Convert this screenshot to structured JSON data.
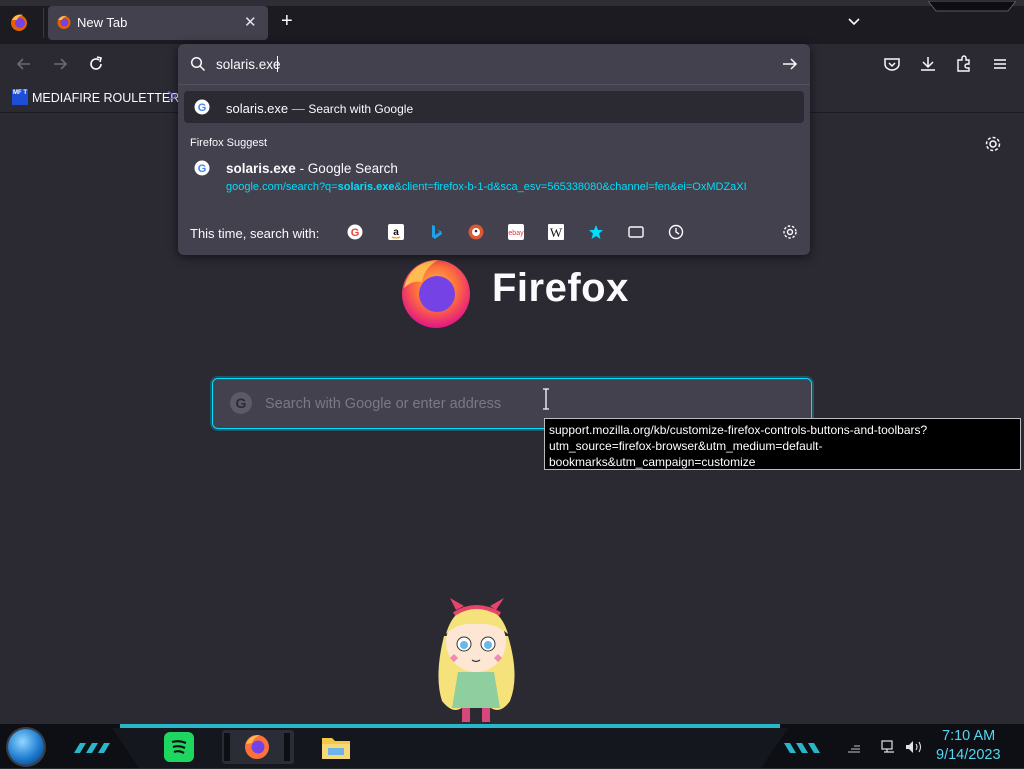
{
  "tabs": [
    {
      "label": "New Tab",
      "close": "✕"
    }
  ],
  "tabstrip": {
    "new_tab": "+"
  },
  "urlbar": {
    "value": "solaris.exe",
    "heuristic_query": "solaris.exe",
    "heuristic_dash": "—",
    "heuristic_action": "Search with Google",
    "suggest_heading": "Firefox Suggest",
    "suggestion": {
      "query": "solaris.exe",
      "suffix": " - Google Search",
      "url_prefix": "google.com/search?q=",
      "url_bold": "solaris.exe",
      "url_rest": "&client=firefox-b-1-d&sca_esv=565338080&channel=fen&ei=OxMDZaXI"
    },
    "one_off_label": "This time, search with:",
    "engines": [
      "google-icon",
      "amazon-icon",
      "bing-icon",
      "duckduckgo-icon",
      "ebay-icon",
      "wikipedia-icon",
      "bookmarks-star-icon",
      "tabs-icon",
      "history-icon"
    ]
  },
  "bookmarks": [
    {
      "icon_text": "MF T",
      "label": "MEDIAFIRE ROULETTER"
    }
  ],
  "newtab": {
    "brand": "Firefox",
    "search_placeholder": "Search with Google or enter address"
  },
  "tooltip": {
    "text": "support.mozilla.org/kb/customize-firefox-controls-buttons-and-toolbars?utm_source=firefox-browser&utm_medium=default-bookmarks&utm_campaign=customize"
  },
  "taskbar": {
    "time": "7:10 AM",
    "date": "9/14/2023"
  },
  "colors": {
    "accent": "#00ddff",
    "toolbar": "#2b2a33",
    "popup": "#42414d",
    "tabstrip": "#1c1b22",
    "clock": "#55d6ee"
  }
}
